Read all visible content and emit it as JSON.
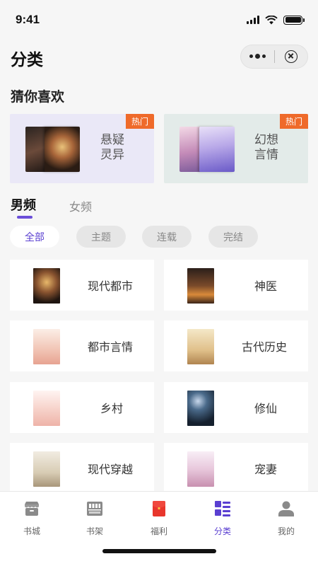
{
  "status_bar": {
    "time": "9:41"
  },
  "header": {
    "title": "分类"
  },
  "recommend": {
    "title": "猜你喜欢",
    "cards": [
      {
        "badge": "热门",
        "label": "悬疑灵异"
      },
      {
        "badge": "热门",
        "label": "幻想言情"
      }
    ]
  },
  "gender_tabs": [
    {
      "label": "男频",
      "active": true
    },
    {
      "label": "女频",
      "active": false
    }
  ],
  "filters": [
    {
      "label": "全部",
      "active": true
    },
    {
      "label": "主题",
      "active": false
    },
    {
      "label": "连载",
      "active": false
    },
    {
      "label": "完结",
      "active": false
    }
  ],
  "categories": [
    {
      "label": "现代都市"
    },
    {
      "label": "神医"
    },
    {
      "label": "都市言情"
    },
    {
      "label": "古代历史"
    },
    {
      "label": "乡村"
    },
    {
      "label": "修仙"
    },
    {
      "label": "现代穿越"
    },
    {
      "label": "宠妻"
    }
  ],
  "tabbar": [
    {
      "label": "书城",
      "icon": "bookstore-icon",
      "active": false
    },
    {
      "label": "书架",
      "icon": "bookshelf-icon",
      "active": false
    },
    {
      "label": "福利",
      "icon": "red-envelope-icon",
      "active": false
    },
    {
      "label": "分类",
      "icon": "category-icon",
      "active": true
    },
    {
      "label": "我的",
      "icon": "profile-icon",
      "active": false
    }
  ],
  "colors": {
    "accent": "#5a3fd1",
    "hot_badge": "#ef6a2a",
    "card_purple": "#eae8f7",
    "card_green": "#e3ebe9"
  }
}
